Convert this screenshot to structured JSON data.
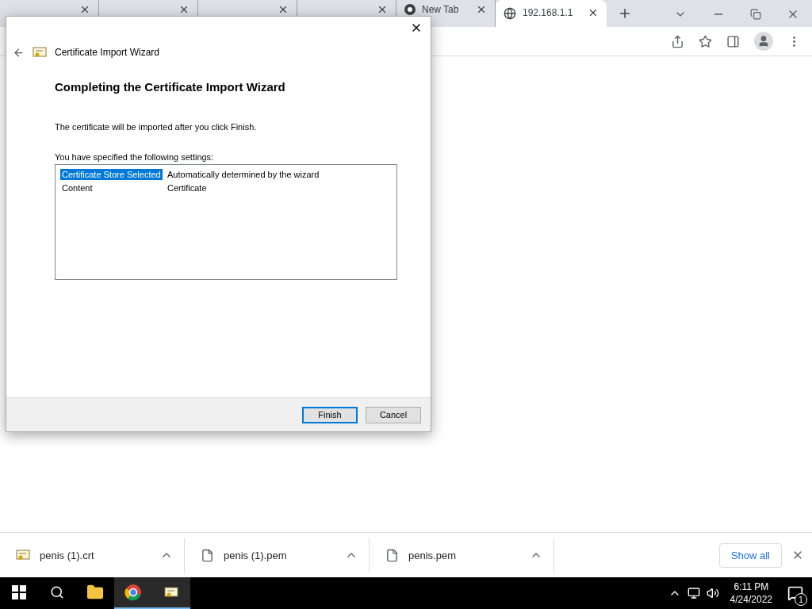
{
  "browser": {
    "tabs": [
      {
        "selected": false
      },
      {
        "selected": false
      },
      {
        "selected": false
      },
      {
        "selected": false
      },
      {
        "title": "New Tab",
        "selected": false
      },
      {
        "title": "192.168.1.1",
        "selected": true
      }
    ]
  },
  "dialog": {
    "title": "Certificate Import Wizard",
    "heading": "Completing the Certificate Import Wizard",
    "intro": "The certificate will be imported after you click Finish.",
    "settings_label": "You have specified the following settings:",
    "settings": [
      {
        "name": "Certificate Store Selected",
        "value": "Automatically determined by the wizard",
        "selected": true
      },
      {
        "name": "Content",
        "value": "Certificate",
        "selected": false
      }
    ],
    "buttons": [
      {
        "label": "Finish",
        "default": true
      },
      {
        "label": "Cancel",
        "default": false
      }
    ]
  },
  "downloads": {
    "items": [
      {
        "name": "penis (1).crt",
        "kind": "certificate"
      },
      {
        "name": "penis (1).pem",
        "kind": "file"
      },
      {
        "name": "penis.pem",
        "kind": "file"
      }
    ],
    "show_all": "Show all"
  },
  "taskbar": {
    "apps": [
      {
        "kind": "explorer",
        "active": false
      },
      {
        "kind": "chrome",
        "active": true
      },
      {
        "kind": "certificate",
        "active": true
      }
    ],
    "time": "6:11 PM",
    "date": "4/24/2022",
    "notifications": "1"
  }
}
